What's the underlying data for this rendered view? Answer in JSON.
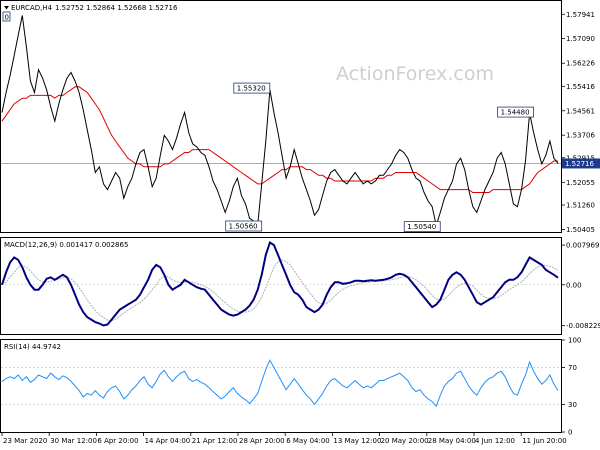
{
  "chart_data": {
    "type": "line",
    "header": {
      "symbol": "EURCAD,H4",
      "values": "1.52752 1.52864 1.52668 1.52716",
      "badge": "0"
    },
    "watermark": "ActionForex.com",
    "colors": {
      "price": "#000000",
      "sma": "#e00000",
      "macd": "#000080",
      "signal": "#b0b0b0",
      "rsi": "#1e90ff",
      "current_price_tag": "#1e3a8a"
    },
    "x_labels": [
      "23 Mar 2020",
      "30 Mar 12:00",
      "6 Apr 20:00",
      "14 Apr 04:00",
      "21 Apr 12:00",
      "28 Apr 20:00",
      "6 May 04:00",
      "13 May 12:00",
      "20 May 20:00",
      "28 May 04:00",
      "4 Jun 12:00",
      "11 Jun 20:00"
    ],
    "panels": {
      "price": {
        "ylim": [
          1.5035,
          1.583
        ],
        "ticks": [
          "1.57941",
          "1.57090",
          "1.56226",
          "1.55416",
          "1.54561",
          "1.53706",
          "1.52915",
          "1.52055",
          "1.51260",
          "1.50405"
        ],
        "current_price": "1.52716",
        "current_price_value": 1.52716,
        "annotations": [
          {
            "label": "1.55320",
            "x_index": 65,
            "value": 1.5532
          },
          {
            "label": "1.50560",
            "x_index": 63,
            "value": 1.5056
          },
          {
            "label": "1.50540",
            "x_index": 107,
            "value": 1.5054
          },
          {
            "label": "1.54480",
            "x_index": 130,
            "value": 1.5448
          }
        ],
        "series": [
          {
            "name": "price",
            "values": [
              1.545,
              1.552,
              1.558,
              1.565,
              1.572,
              1.579,
              1.568,
              1.556,
              1.552,
              1.56,
              1.557,
              1.553,
              1.547,
              1.542,
              1.548,
              1.553,
              1.557,
              1.559,
              1.556,
              1.552,
              1.546,
              1.539,
              1.532,
              1.524,
              1.526,
              1.52,
              1.518,
              1.521,
              1.524,
              1.522,
              1.515,
              1.519,
              1.522,
              1.527,
              1.531,
              1.532,
              1.526,
              1.519,
              1.522,
              1.53,
              1.537,
              1.535,
              1.532,
              1.536,
              1.541,
              1.545,
              1.538,
              1.534,
              1.533,
              1.531,
              1.53,
              1.526,
              1.521,
              1.518,
              1.514,
              1.51,
              1.514,
              1.519,
              1.522,
              1.516,
              1.513,
              1.508,
              1.507,
              1.5056,
              1.52,
              1.535,
              1.553,
              1.545,
              1.538,
              1.53,
              1.522,
              1.526,
              1.532,
              1.527,
              1.522,
              1.518,
              1.514,
              1.509,
              1.511,
              1.516,
              1.521,
              1.524,
              1.525,
              1.523,
              1.521,
              1.52,
              1.522,
              1.524,
              1.522,
              1.52,
              1.521,
              1.52,
              1.521,
              1.523,
              1.523,
              1.525,
              1.527,
              1.53,
              1.532,
              1.531,
              1.529,
              1.525,
              1.522,
              1.521,
              1.517,
              1.514,
              1.512,
              1.5054,
              1.51,
              1.515,
              1.518,
              1.521,
              1.527,
              1.529,
              1.525,
              1.518,
              1.512,
              1.51,
              1.514,
              1.518,
              1.521,
              1.524,
              1.529,
              1.531,
              1.527,
              1.52,
              1.513,
              1.512,
              1.518,
              1.528,
              1.5448,
              1.538,
              1.532,
              1.527,
              1.53,
              1.535,
              1.529,
              1.52716
            ]
          },
          {
            "name": "sma",
            "values": [
              1.542,
              1.544,
              1.546,
              1.548,
              1.549,
              1.55,
              1.55,
              1.551,
              1.551,
              1.551,
              1.551,
              1.551,
              1.551,
              1.55,
              1.551,
              1.551,
              1.552,
              1.553,
              1.554,
              1.554,
              1.553,
              1.552,
              1.55,
              1.548,
              1.546,
              1.543,
              1.54,
              1.537,
              1.535,
              1.533,
              1.531,
              1.529,
              1.528,
              1.527,
              1.527,
              1.526,
              1.526,
              1.526,
              1.526,
              1.526,
              1.527,
              1.527,
              1.528,
              1.529,
              1.53,
              1.531,
              1.531,
              1.532,
              1.532,
              1.532,
              1.532,
              1.532,
              1.531,
              1.53,
              1.529,
              1.528,
              1.527,
              1.526,
              1.525,
              1.524,
              1.523,
              1.522,
              1.521,
              1.52,
              1.52,
              1.521,
              1.522,
              1.523,
              1.524,
              1.525,
              1.525,
              1.526,
              1.526,
              1.526,
              1.526,
              1.525,
              1.525,
              1.524,
              1.523,
              1.523,
              1.522,
              1.522,
              1.521,
              1.521,
              1.521,
              1.521,
              1.521,
              1.521,
              1.521,
              1.521,
              1.521,
              1.521,
              1.522,
              1.522,
              1.522,
              1.523,
              1.523,
              1.524,
              1.524,
              1.524,
              1.524,
              1.524,
              1.524,
              1.523,
              1.522,
              1.521,
              1.52,
              1.519,
              1.518,
              1.518,
              1.518,
              1.518,
              1.518,
              1.518,
              1.518,
              1.518,
              1.517,
              1.517,
              1.517,
              1.517,
              1.517,
              1.518,
              1.518,
              1.518,
              1.518,
              1.518,
              1.518,
              1.518,
              1.518,
              1.519,
              1.52,
              1.522,
              1.524,
              1.525,
              1.526,
              1.527,
              1.528,
              1.528
            ]
          }
        ]
      },
      "macd": {
        "label": "MACD(12,26,9) 0.001417 0.002865",
        "ylim": [
          -0.0097,
          0.0094
        ],
        "ticks": [
          "0.007969",
          "0.00",
          "-0.008229"
        ],
        "series": [
          {
            "name": "macd",
            "values": [
              0.0,
              0.0025,
              0.0045,
              0.0055,
              0.005,
              0.0035,
              0.0015,
              0.0,
              -0.001,
              -0.001,
              0.0,
              0.0012,
              0.0015,
              0.001,
              0.0015,
              0.002,
              0.0015,
              0.0,
              -0.002,
              -0.004,
              -0.0055,
              -0.0065,
              -0.007,
              -0.0075,
              -0.0078,
              -0.0082,
              -0.008,
              -0.007,
              -0.006,
              -0.005,
              -0.0045,
              -0.004,
              -0.0035,
              -0.003,
              -0.002,
              -0.0005,
              0.001,
              0.003,
              0.004,
              0.0035,
              0.002,
              0.0,
              -0.001,
              -0.0005,
              0.0,
              0.001,
              0.0005,
              0.0,
              -0.0005,
              -0.0008,
              -0.001,
              -0.002,
              -0.003,
              -0.004,
              -0.005,
              -0.0055,
              -0.006,
              -0.0062,
              -0.006,
              -0.0055,
              -0.005,
              -0.0042,
              -0.003,
              -0.001,
              0.002,
              0.006,
              0.0085,
              0.008,
              0.006,
              0.004,
              0.002,
              0.0,
              -0.0015,
              -0.002,
              -0.003,
              -0.0045,
              -0.005,
              -0.0055,
              -0.005,
              -0.004,
              -0.002,
              -0.0005,
              0.0005,
              0.0005,
              0.0002,
              0.0003,
              0.0005,
              0.0008,
              0.0008,
              0.0007,
              0.0008,
              0.0009,
              0.0008,
              0.0009,
              0.001,
              0.0012,
              0.0015,
              0.002,
              0.0022,
              0.002,
              0.0015,
              0.0005,
              -0.0005,
              -0.0015,
              -0.0025,
              -0.0035,
              -0.0045,
              -0.004,
              -0.003,
              -0.001,
              0.001,
              0.002,
              0.0025,
              0.002,
              0.001,
              -0.0005,
              -0.002,
              -0.0035,
              -0.004,
              -0.0035,
              -0.003,
              -0.0025,
              -0.0015,
              -0.0005,
              0.0005,
              0.001,
              0.001,
              0.0015,
              0.0025,
              0.004,
              0.0055,
              0.005,
              0.0045,
              0.004,
              0.003,
              0.0025,
              0.002,
              0.001417
            ]
          },
          {
            "name": "signal",
            "values": [
              0.0,
              0.0005,
              0.0015,
              0.0025,
              0.0035,
              0.0038,
              0.0035,
              0.0028,
              0.0018,
              0.001,
              0.0006,
              0.0005,
              0.0007,
              0.0009,
              0.0011,
              0.0014,
              0.0015,
              0.0012,
              0.0004,
              -0.0006,
              -0.0018,
              -0.003,
              -0.0042,
              -0.0052,
              -0.006,
              -0.0066,
              -0.0071,
              -0.0072,
              -0.0069,
              -0.0063,
              -0.0057,
              -0.0051,
              -0.0046,
              -0.0041,
              -0.0036,
              -0.0029,
              -0.002,
              -0.001,
              0.0,
              0.0012,
              0.0018,
              0.0016,
              0.001,
              0.0006,
              0.0004,
              0.0005,
              0.0006,
              0.0005,
              0.0003,
              0.0,
              -0.0003,
              -0.0008,
              -0.0014,
              -0.0021,
              -0.0029,
              -0.0036,
              -0.0043,
              -0.0049,
              -0.0053,
              -0.0055,
              -0.0055,
              -0.0053,
              -0.0048,
              -0.0039,
              -0.0025,
              -0.0006,
              0.0015,
              0.0035,
              0.0046,
              0.005,
              0.0047,
              0.004,
              0.0028,
              0.0016,
              0.0005,
              -0.0007,
              -0.0018,
              -0.0028,
              -0.0036,
              -0.0039,
              -0.0037,
              -0.0031,
              -0.0023,
              -0.0015,
              -0.0009,
              -0.0005,
              -0.0002,
              0.0,
              0.0003,
              0.0004,
              0.0005,
              0.0006,
              0.0007,
              0.0007,
              0.0008,
              0.0009,
              0.001,
              0.0012,
              0.0014,
              0.0016,
              0.0016,
              0.0014,
              0.001,
              0.0004,
              -0.0003,
              -0.0012,
              -0.0022,
              -0.0029,
              -0.0031,
              -0.0029,
              -0.0022,
              -0.0013,
              -0.0005,
              0.0001,
              0.0003,
              0.0002,
              -0.0003,
              -0.0011,
              -0.0019,
              -0.0025,
              -0.0027,
              -0.0028,
              -0.0026,
              -0.0022,
              -0.0016,
              -0.001,
              -0.0005,
              0.0,
              0.0006,
              0.0013,
              0.0022,
              0.003,
              0.0036,
              0.0039,
              0.0039,
              0.0037,
              0.0034,
              0.002865
            ]
          }
        ]
      },
      "rsi": {
        "label": "RSI(14) 44.9742",
        "ylim": [
          0,
          100
        ],
        "ticks": [
          "100",
          "70",
          "30",
          "0"
        ],
        "levels": [
          30,
          70
        ],
        "series": [
          {
            "name": "rsi",
            "values": [
              55,
              58,
              60,
              58,
              62,
              56,
              60,
              54,
              57,
              62,
              60,
              58,
              64,
              60,
              57,
              61,
              59,
              55,
              50,
              45,
              38,
              42,
              40,
              45,
              40,
              37,
              44,
              48,
              50,
              44,
              36,
              40,
              46,
              50,
              56,
              60,
              52,
              48,
              55,
              63,
              67,
              60,
              55,
              60,
              64,
              66,
              58,
              55,
              57,
              54,
              52,
              48,
              44,
              40,
              36,
              39,
              44,
              48,
              42,
              38,
              35,
              31,
              36,
              42,
              55,
              68,
              78,
              70,
              62,
              54,
              46,
              52,
              58,
              52,
              46,
              40,
              36,
              30,
              36,
              42,
              50,
              56,
              58,
              54,
              50,
              48,
              52,
              56,
              52,
              48,
              50,
              48,
              52,
              56,
              56,
              58,
              60,
              62,
              64,
              60,
              56,
              48,
              44,
              46,
              40,
              36,
              33,
              28,
              40,
              50,
              55,
              58,
              64,
              66,
              58,
              50,
              44,
              40,
              48,
              54,
              58,
              60,
              64,
              66,
              60,
              50,
              42,
              40,
              52,
              62,
              76,
              66,
              58,
              52,
              56,
              62,
              52,
              45
            ]
          }
        ]
      }
    }
  }
}
